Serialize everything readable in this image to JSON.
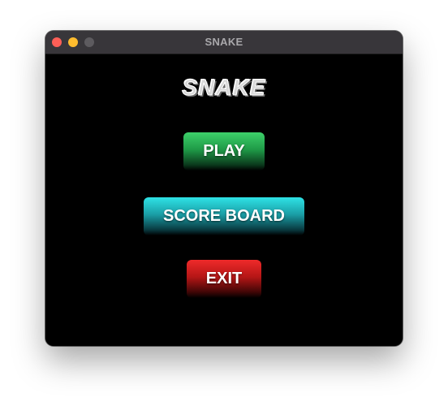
{
  "window": {
    "title": "SNAKE"
  },
  "game": {
    "title": "SNAKE"
  },
  "menu": {
    "play_label": "PLAY",
    "score_board_label": "SCORE BOARD",
    "exit_label": "EXIT"
  },
  "colors": {
    "play_button": "#2ecc5f",
    "score_board_button": "#2adfe3",
    "exit_button": "#e21f1f",
    "background": "#000000"
  }
}
